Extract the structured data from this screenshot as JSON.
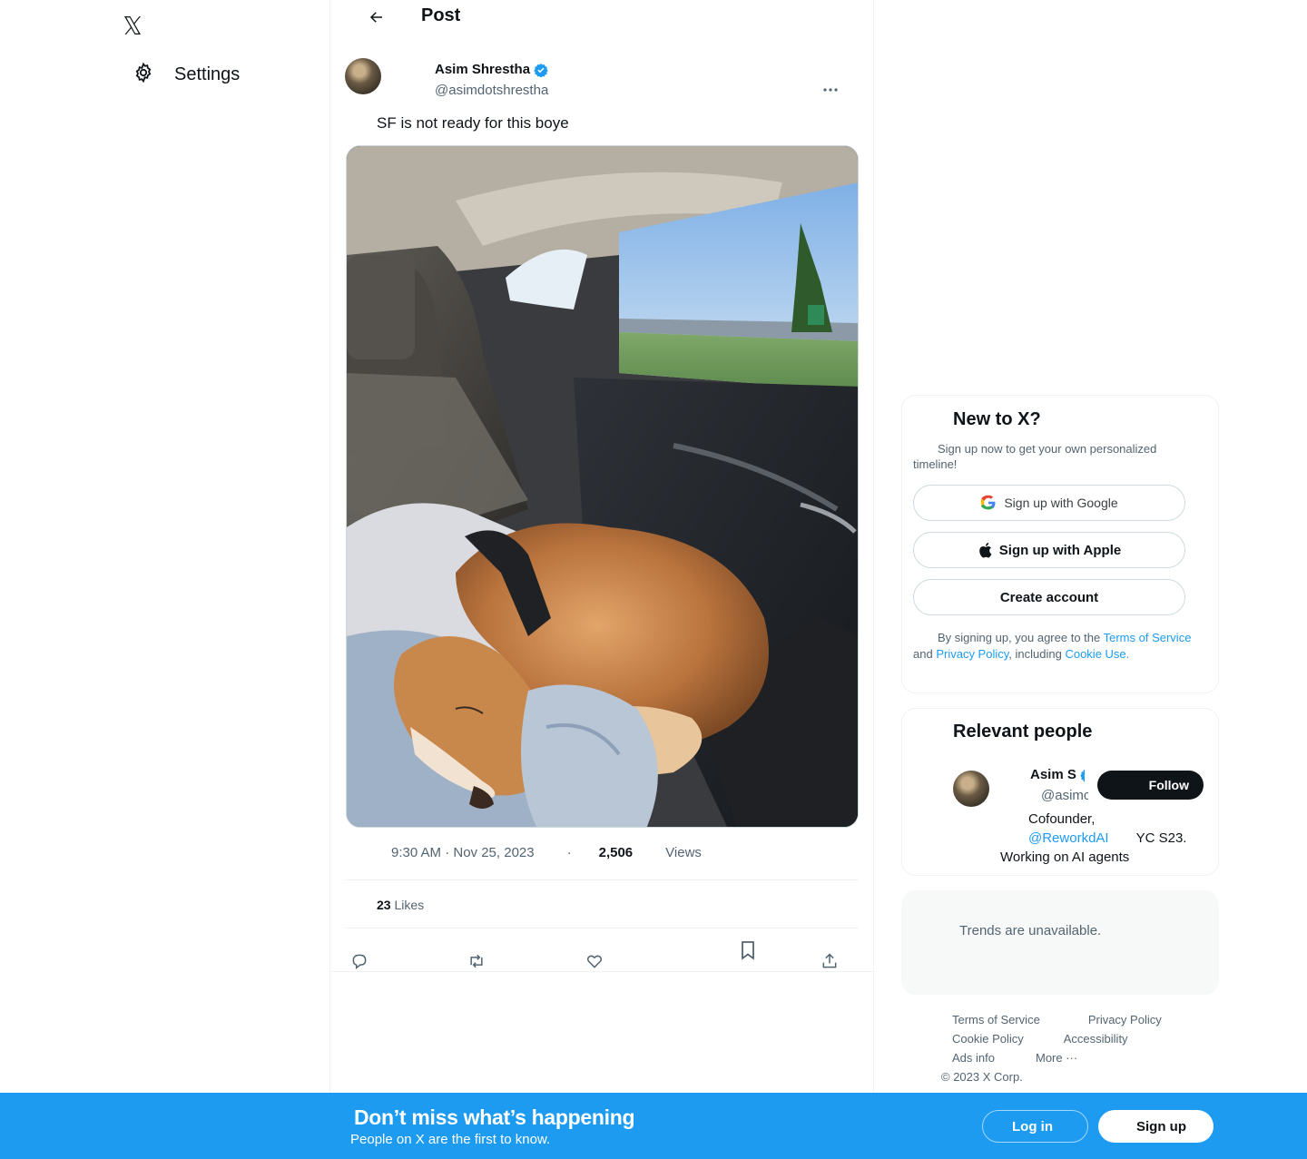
{
  "nav": {
    "logo_icon": "x-logo-icon",
    "settings_label": "Settings",
    "settings_icon": "gear-icon"
  },
  "header": {
    "title": "Post",
    "back_icon": "arrow-left-icon"
  },
  "post": {
    "author_name": "Asim Shrestha",
    "author_handle": "@asimdotshrestha",
    "verified": true,
    "text": "SF is not ready for this boye",
    "time": "9:30 AM · Nov 25, 2023",
    "dot": "·",
    "views_count": "2,506",
    "views_label": "Views",
    "likes_count": "23",
    "likes_label": "Likes",
    "more_icon": "more-horizontal-icon",
    "actions": [
      "reply-icon",
      "retweet-icon",
      "like-icon",
      "bookmark-icon",
      "share-icon"
    ]
  },
  "new_to_x": {
    "title": "New to X?",
    "subtitle": "Sign up now to get your own personalized timeline!",
    "google_label": "Sign up with Google",
    "apple_label": "Sign up with Apple",
    "create_label": "Create account",
    "legal_prefix": "By signing up, you agree to the",
    "terms_label": "Terms of Service",
    "and": "and",
    "privacy_label": "Privacy Policy",
    "including": ", including",
    "cookie_label": "Cookie Use."
  },
  "relevant_people": {
    "title": "Relevant people",
    "name": "Asim S",
    "handle": "@asimc",
    "follow_label": "Follow",
    "bio_1": "Cofounder,",
    "bio_mention": "@ReworkdAI",
    "bio_2": "YC S23.",
    "bio_3": "Working on AI agents"
  },
  "trends": {
    "text": "Trends are unavailable."
  },
  "footer": {
    "terms": "Terms of Service",
    "privacy": "Privacy Policy",
    "cookie": "Cookie Policy",
    "accessibility": "Accessibility",
    "ads": "Ads info",
    "more": "More ···",
    "copyright": "© 2023 X Corp."
  },
  "bottom_bar": {
    "title": "Don’t miss what’s happening",
    "subtitle": "People on X are the first to know.",
    "login_label": "Log in",
    "signup_label": "Sign up"
  },
  "colors": {
    "accent": "#1d9bf0",
    "text": "#0f1419",
    "muted": "#536471"
  }
}
